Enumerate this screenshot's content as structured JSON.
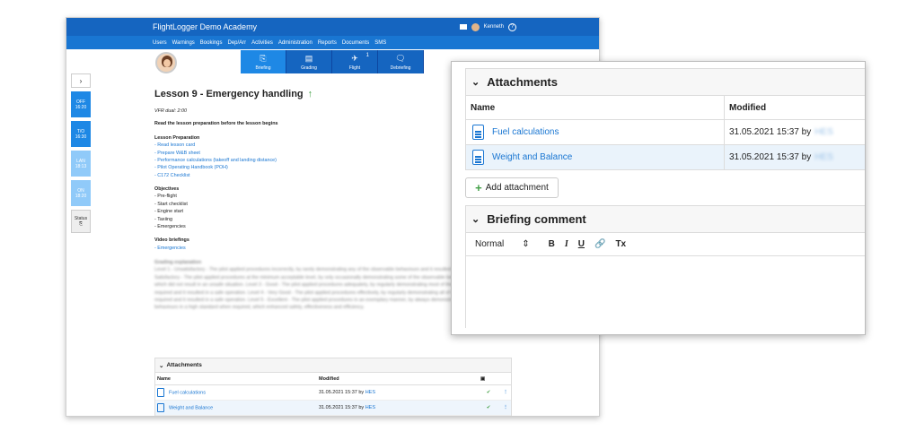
{
  "app": {
    "title": "FlightLogger Demo Academy",
    "user_name": "Kenneth",
    "help_symbol": "?",
    "menu": [
      "Users",
      "Warnings",
      "Bookings",
      "Dep/Arr",
      "Activities",
      "Administration",
      "Reports",
      "Documents",
      "SMS"
    ]
  },
  "sidebar": {
    "toggle": "›",
    "items": [
      {
        "label": "OFF",
        "time": "16:20"
      },
      {
        "label": "T/O",
        "time": "16:30"
      },
      {
        "label": "LAN",
        "time": "18:13"
      },
      {
        "label": "ON",
        "time": "18:20"
      }
    ],
    "status_label": "Status"
  },
  "tabs": [
    {
      "label": "Briefing",
      "glyph": "⎘"
    },
    {
      "label": "Grading",
      "glyph": "▤"
    },
    {
      "label": "Flight",
      "glyph": "✈",
      "badge": "1"
    },
    {
      "label": "Debriefing",
      "glyph": "🗨"
    }
  ],
  "lesson": {
    "title": "Lesson 9 - Emergency handling",
    "subtitle": "VFR dual: 2:00",
    "instruction": "Read the lesson preparation before the lesson begins",
    "prep_heading": "Lesson Preparation",
    "prep_items": [
      "- Read lesson card",
      "- Prepare W&B sheet",
      "- Performance calculations (takeoff and landing distance)",
      "- Pilot Operating Handbook (POH)",
      "- C172 Checklist"
    ],
    "objectives_heading": "Objectives",
    "objectives": [
      "- Pre-flight",
      "- Start checklist",
      "- Engine start",
      "- Taxiing",
      "- Emergencies"
    ],
    "video_heading": "Video briefings",
    "video_items": [
      "- Emergencies"
    ],
    "grading_heading": "Grading explanation",
    "grading_text": "Level 1 - Unsatisfactory - The pilot applied procedures incorrectly, by rarely demonstrating any of the observable behaviours and it resulted in an unsafe situation. Level 2 - Satisfactory - The pilot applied procedures at the minimum acceptable level, by only occasionally demonstrating some of the observable behaviours when required, but which did not result in an unsafe situation. Level 3 - Good - The pilot applied procedures adequately, by regularly demonstrating most of the observable behaviours when required and it resulted in a safe operation. Level 4 - Very Good - The pilot applied procedures effectively, by regularly demonstrating all of the observable behaviours when required and it resulted in a safe operation. Level 5 - Excellent - The pilot applied procedures in an exemplary manner, by always demonstrating all of the observable behaviours in a high standard when required, which enhanced safety, effectiveness and efficiency."
  },
  "attachments": {
    "heading": "Attachments",
    "col_name": "Name",
    "col_modified": "Modified",
    "files": [
      {
        "name": "Fuel calculations",
        "modified": "31.05.2021 15:37 by",
        "user": "HES"
      },
      {
        "name": "Weight and Balance",
        "modified": "31.05.2021 15:37 by",
        "user": "HES"
      }
    ],
    "add_label": "Add attachment"
  },
  "briefing_comment": {
    "heading": "Briefing comment",
    "format_select": "Normal",
    "toolbar": [
      "B",
      "I",
      "U",
      "🔗",
      "Tx"
    ]
  },
  "colors": {
    "brand_dark": "#1565c0",
    "brand": "#1976d2",
    "ok": "#43a047"
  }
}
